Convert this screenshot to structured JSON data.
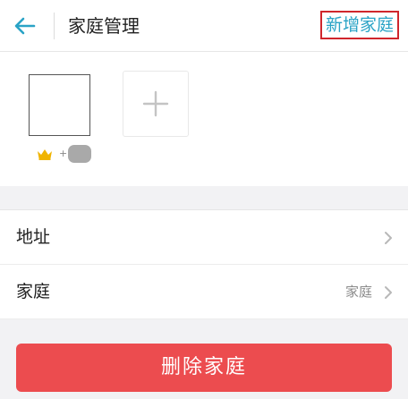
{
  "header": {
    "title": "家庭管理",
    "add_home_label": "新增家庭"
  },
  "members": {
    "owner_badge_icon": "crown-icon",
    "add_member_icon": "plus-icon"
  },
  "list": [
    {
      "label": "地址",
      "value": ""
    },
    {
      "label": "家庭",
      "value": "家庭"
    }
  ],
  "actions": {
    "delete_label": "删除家庭"
  },
  "colors": {
    "accent": "#2aa3c6",
    "danger": "#ec4c4f",
    "highlight_border": "#d0262c",
    "crown": "#f0b400"
  }
}
